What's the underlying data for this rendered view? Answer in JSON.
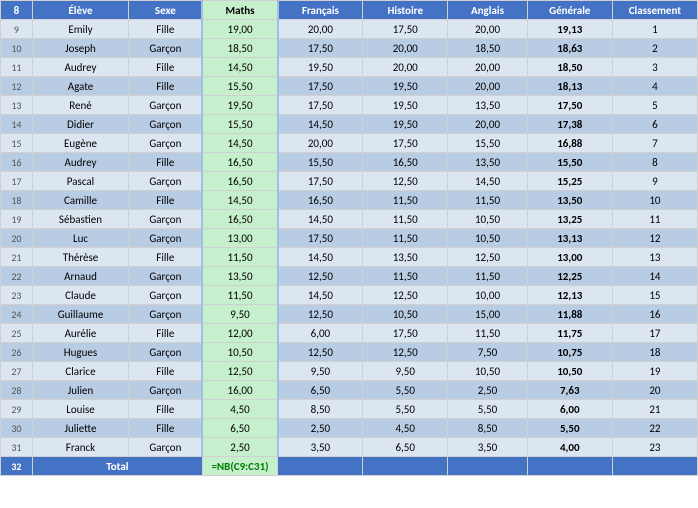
{
  "headers": {
    "row_num": "",
    "eleve": "Élève",
    "sexe": "Sexe",
    "maths": "Maths",
    "francais": "Français",
    "histoire": "Histoire",
    "anglais": "Anglais",
    "generale": "Générale",
    "classement": "Classement"
  },
  "rows": [
    {
      "num": "9",
      "eleve": "Emily",
      "sexe": "Fille",
      "maths": "19,00",
      "francais": "20,00",
      "histoire": "17,50",
      "anglais": "20,00",
      "generale": "19,13",
      "classement": "1"
    },
    {
      "num": "10",
      "eleve": "Joseph",
      "sexe": "Garçon",
      "maths": "18,50",
      "francais": "17,50",
      "histoire": "20,00",
      "anglais": "18,50",
      "generale": "18,63",
      "classement": "2"
    },
    {
      "num": "11",
      "eleve": "Audrey",
      "sexe": "Fille",
      "maths": "14,50",
      "francais": "19,50",
      "histoire": "20,00",
      "anglais": "20,00",
      "generale": "18,50",
      "classement": "3"
    },
    {
      "num": "12",
      "eleve": "Agate",
      "sexe": "Fille",
      "maths": "15,50",
      "francais": "17,50",
      "histoire": "19,50",
      "anglais": "20,00",
      "generale": "18,13",
      "classement": "4"
    },
    {
      "num": "13",
      "eleve": "René",
      "sexe": "Garçon",
      "maths": "19,50",
      "francais": "17,50",
      "histoire": "19,50",
      "anglais": "13,50",
      "generale": "17,50",
      "classement": "5"
    },
    {
      "num": "14",
      "eleve": "Didier",
      "sexe": "Garçon",
      "maths": "15,50",
      "francais": "14,50",
      "histoire": "19,50",
      "anglais": "20,00",
      "generale": "17,38",
      "classement": "6"
    },
    {
      "num": "15",
      "eleve": "Eugène",
      "sexe": "Garçon",
      "maths": "14,50",
      "francais": "20,00",
      "histoire": "17,50",
      "anglais": "15,50",
      "generale": "16,88",
      "classement": "7"
    },
    {
      "num": "16",
      "eleve": "Audrey",
      "sexe": "Fille",
      "maths": "16,50",
      "francais": "15,50",
      "histoire": "16,50",
      "anglais": "13,50",
      "generale": "15,50",
      "classement": "8"
    },
    {
      "num": "17",
      "eleve": "Pascal",
      "sexe": "Garçon",
      "maths": "16,50",
      "francais": "17,50",
      "histoire": "12,50",
      "anglais": "14,50",
      "generale": "15,25",
      "classement": "9"
    },
    {
      "num": "18",
      "eleve": "Camille",
      "sexe": "Fille",
      "maths": "14,50",
      "francais": "16,50",
      "histoire": "11,50",
      "anglais": "11,50",
      "generale": "13,50",
      "classement": "10"
    },
    {
      "num": "19",
      "eleve": "Sébastien",
      "sexe": "Garçon",
      "maths": "16,50",
      "francais": "14,50",
      "histoire": "11,50",
      "anglais": "10,50",
      "generale": "13,25",
      "classement": "11"
    },
    {
      "num": "20",
      "eleve": "Luc",
      "sexe": "Garçon",
      "maths": "13,00",
      "francais": "17,50",
      "histoire": "11,50",
      "anglais": "10,50",
      "generale": "13,13",
      "classement": "12"
    },
    {
      "num": "21",
      "eleve": "Thérèse",
      "sexe": "Fille",
      "maths": "11,50",
      "francais": "14,50",
      "histoire": "13,50",
      "anglais": "12,50",
      "generale": "13,00",
      "classement": "13"
    },
    {
      "num": "22",
      "eleve": "Arnaud",
      "sexe": "Garçon",
      "maths": "13,50",
      "francais": "12,50",
      "histoire": "11,50",
      "anglais": "11,50",
      "generale": "12,25",
      "classement": "14"
    },
    {
      "num": "23",
      "eleve": "Claude",
      "sexe": "Garçon",
      "maths": "11,50",
      "francais": "14,50",
      "histoire": "12,50",
      "anglais": "10,00",
      "generale": "12,13",
      "classement": "15"
    },
    {
      "num": "24",
      "eleve": "Guillaume",
      "sexe": "Garçon",
      "maths": "9,50",
      "francais": "12,50",
      "histoire": "10,50",
      "anglais": "15,00",
      "generale": "11,88",
      "classement": "16"
    },
    {
      "num": "25",
      "eleve": "Aurélie",
      "sexe": "Fille",
      "maths": "12,00",
      "francais": "6,00",
      "histoire": "17,50",
      "anglais": "11,50",
      "generale": "11,75",
      "classement": "17"
    },
    {
      "num": "26",
      "eleve": "Hugues",
      "sexe": "Garçon",
      "maths": "10,50",
      "francais": "12,50",
      "histoire": "12,50",
      "anglais": "7,50",
      "generale": "10,75",
      "classement": "18"
    },
    {
      "num": "27",
      "eleve": "Clarice",
      "sexe": "Fille",
      "maths": "12,50",
      "francais": "9,50",
      "histoire": "9,50",
      "anglais": "10,50",
      "generale": "10,50",
      "classement": "19"
    },
    {
      "num": "28",
      "eleve": "Julien",
      "sexe": "Garçon",
      "maths": "16,00",
      "francais": "6,50",
      "histoire": "5,50",
      "anglais": "2,50",
      "generale": "7,63",
      "classement": "20"
    },
    {
      "num": "29",
      "eleve": "Louise",
      "sexe": "Fille",
      "maths": "4,50",
      "francais": "8,50",
      "histoire": "5,50",
      "anglais": "5,50",
      "generale": "6,00",
      "classement": "21"
    },
    {
      "num": "30",
      "eleve": "Juliette",
      "sexe": "Fille",
      "maths": "6,50",
      "francais": "2,50",
      "histoire": "4,50",
      "anglais": "8,50",
      "generale": "5,50",
      "classement": "22"
    },
    {
      "num": "31",
      "eleve": "Franck",
      "sexe": "Garçon",
      "maths": "2,50",
      "francais": "3,50",
      "histoire": "6,50",
      "anglais": "3,50",
      "generale": "4,00",
      "classement": "23"
    }
  ],
  "total_row": {
    "num": "32",
    "label": "Total",
    "formula": "NB(C9:C31)"
  }
}
